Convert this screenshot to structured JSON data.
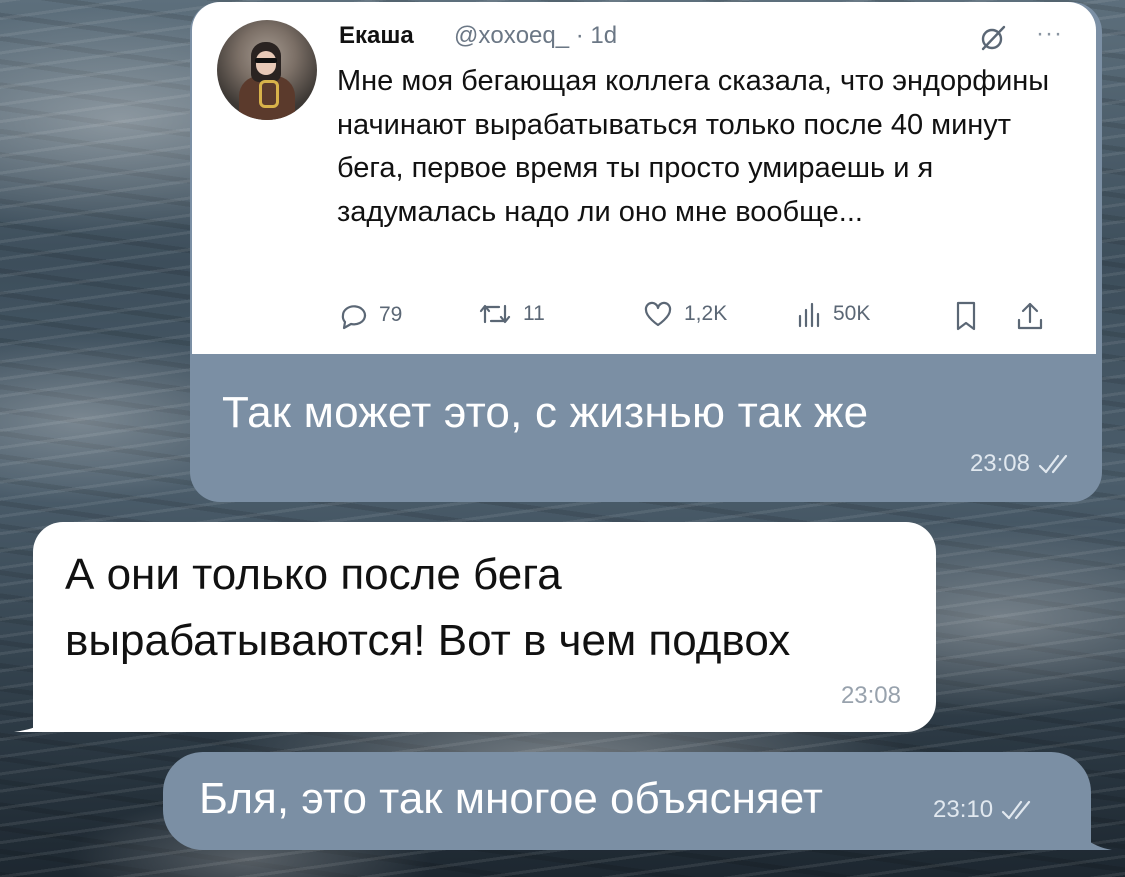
{
  "messages": [
    {
      "direction": "outgoing",
      "embedded_tweet": {
        "author_name": "Екаша",
        "handle_meta": "@xoxoeq_ · 1d",
        "text": "Мне моя бегающая коллега сказала, что эндорфины начинают вырабатываться только после 40 минут бега, первое время ты просто умираешь и я задумалась надо ли оно мне вообще...",
        "stats": {
          "replies": "79",
          "retweets": "11",
          "likes": "1,2K",
          "views": "50K"
        },
        "icons": [
          "grok-icon",
          "more-icon",
          "reply-icon",
          "retweet-icon",
          "like-icon",
          "views-icon",
          "bookmark-icon",
          "share-icon"
        ]
      },
      "text": "Так может это, с жизнью так же",
      "time": "23:08",
      "status": "read"
    },
    {
      "direction": "incoming",
      "text": "А они только после бега вырабатываются! Вот в чем подвох",
      "time": "23:08"
    },
    {
      "direction": "outgoing",
      "text": "Бля, это так многое объясняет",
      "time": "23:10",
      "status": "read"
    }
  ],
  "colors": {
    "outgoing_bubble": "#7b8fa4",
    "incoming_bubble": "#ffffff",
    "tweet_meta": "#6b7785"
  }
}
